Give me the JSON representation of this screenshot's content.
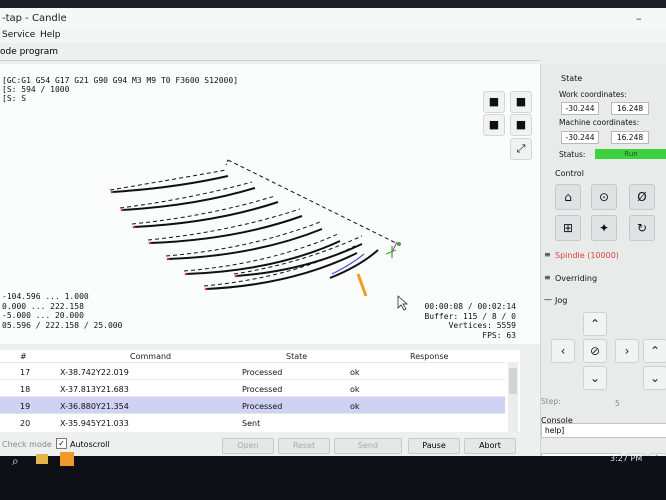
{
  "window": {
    "title": "-tap - Candle",
    "menu": [
      "Service",
      "Help"
    ],
    "tab": "ode program"
  },
  "viewer": {
    "status_lines": [
      "[GC:G1 G54 G17 G21 G90 G94 M3 M9 T0 F3600 S12000]",
      "[S: 594 / 1000",
      "[S: S"
    ],
    "limits": [
      "-104.596 ... 1.000",
      "0.000 ... 222.158",
      "-5.000 ... 20.000",
      "05.596 / 222.158 / 25.000"
    ],
    "info": [
      "00:00:08 / 00:02:14",
      "Buffer: 115 / 8 / 0",
      "Vertices: 5559",
      "FPS: 63"
    ],
    "view_icons": [
      "cube-front-icon",
      "cube-top-icon",
      "cube-left-icon",
      "cube-iso-icon",
      "fit-icon"
    ]
  },
  "table": {
    "headers": [
      "#",
      "Command",
      "State",
      "Response"
    ],
    "rows": [
      {
        "num": "17",
        "command": "X-38.742Y22.019",
        "state": "Processed",
        "response": "ok"
      },
      {
        "num": "18",
        "command": "X-37.813Y21.683",
        "state": "Processed",
        "response": "ok"
      },
      {
        "num": "19",
        "command": "X-36.880Y21.354",
        "state": "Processed",
        "response": "ok"
      },
      {
        "num": "20",
        "command": "X-35.945Y21.033",
        "state": "Sent",
        "response": ""
      }
    ],
    "selected_row": 2
  },
  "bottom": {
    "check_mode": "Check mode",
    "autoscroll": "Autoscroll",
    "buttons": {
      "open": "Open",
      "reset": "Reset",
      "send": "Send",
      "pause": "Pause",
      "abort": "Abort"
    }
  },
  "state_panel": {
    "title": "State",
    "work_label": "Work coordinates:",
    "work": [
      "-30.244",
      "16.248"
    ],
    "machine_label": "Machine coordinates:",
    "machine": [
      "-30.244",
      "16.248"
    ],
    "status_label": "Status:",
    "status_value": "Run",
    "status_color": "#3ed13e"
  },
  "control": {
    "title": "Control",
    "icons": [
      "home-icon",
      "zero-search-icon",
      "zero-z-icon",
      "zero-xy-icon",
      "run-icon",
      "reset-icon"
    ]
  },
  "spindle": {
    "label": "Spindle (10000)",
    "color": "#d9453b"
  },
  "overriding": {
    "label": "Overriding"
  },
  "jog": {
    "label": "Jog",
    "step_label": "Step:",
    "step_value": "5"
  },
  "console": {
    "label": "Console",
    "text": "help]"
  },
  "taskbar": {
    "time": "3:27 PM"
  }
}
